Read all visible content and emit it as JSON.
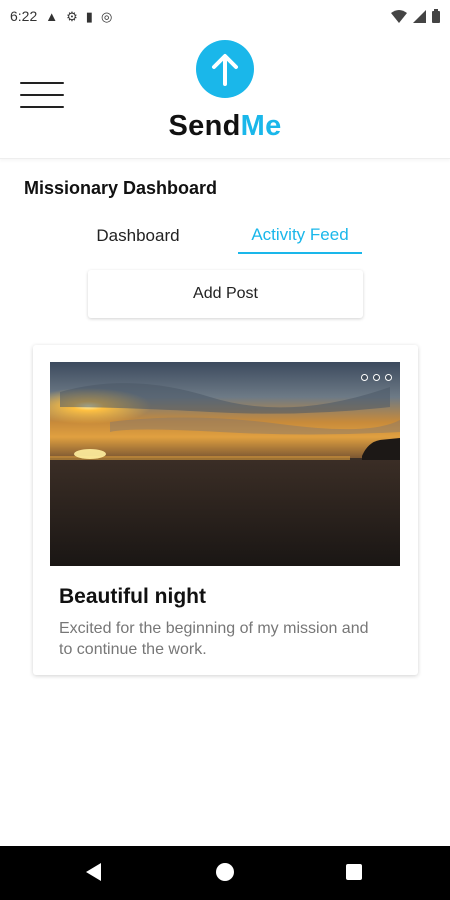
{
  "statusbar": {
    "time": "6:22",
    "icons": [
      "warning-icon",
      "gear-icon",
      "sd-card-icon",
      "sync-icon",
      "wifi-icon",
      "signal-icon",
      "battery-icon"
    ]
  },
  "header": {
    "brand_part1": "Send",
    "brand_part2": "Me",
    "accent_color": "#1ab7ea"
  },
  "page": {
    "title": "Missionary Dashboard",
    "tabs": [
      {
        "label": "Dashboard",
        "active": false
      },
      {
        "label": "Activity Feed",
        "active": true
      }
    ],
    "add_post_label": "Add Post"
  },
  "post": {
    "title": "Beautiful night",
    "body": "Excited for the beginning of my mission and to continue the work."
  },
  "navbar": {
    "buttons": [
      "back",
      "home",
      "recents"
    ]
  }
}
